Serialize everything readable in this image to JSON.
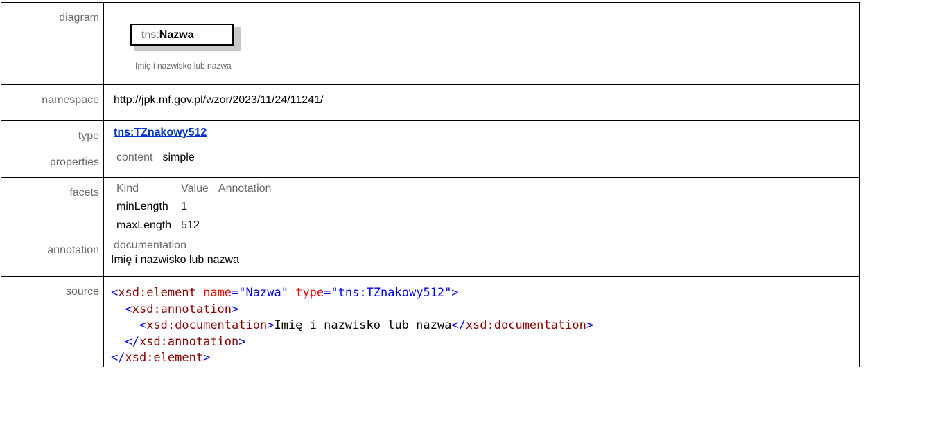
{
  "rows": {
    "diagram": {
      "label": "diagram",
      "element_prefix": "tns:",
      "element_name": "Nazwa",
      "documentation": "Imię i nazwisko lub nazwa"
    },
    "namespace": {
      "label": "namespace",
      "value": "http://jpk.mf.gov.pl/wzor/2023/11/24/11241/"
    },
    "type": {
      "label": "type",
      "value": "tns:TZnakowy512"
    },
    "properties": {
      "label": "properties",
      "key": "content",
      "value": "simple"
    },
    "facets": {
      "label": "facets",
      "headers": [
        "Kind",
        "Value",
        "Annotation"
      ],
      "items": [
        {
          "kind": "minLength",
          "value": "1",
          "annotation": ""
        },
        {
          "kind": "maxLength",
          "value": "512",
          "annotation": ""
        }
      ]
    },
    "annotation": {
      "label": "annotation",
      "heading": "documentation",
      "text": "Imię i nazwisko lub nazwa"
    },
    "source": {
      "label": "source",
      "lines": {
        "l1_tag": "xsd:element",
        "l1_attr1": "name",
        "l1_val1": "\"Nazwa\"",
        "l1_attr2": "type",
        "l1_val2": "\"tns:TZnakowy512\"",
        "l2_tag": "xsd:annotation",
        "l3_tag_open": "xsd:documentation",
        "l3_text": "Imię i nazwisko lub nazwa",
        "l3_tag_close": "xsd:documentation",
        "l4_tag": "xsd:annotation",
        "l5_tag": "xsd:element"
      }
    }
  }
}
